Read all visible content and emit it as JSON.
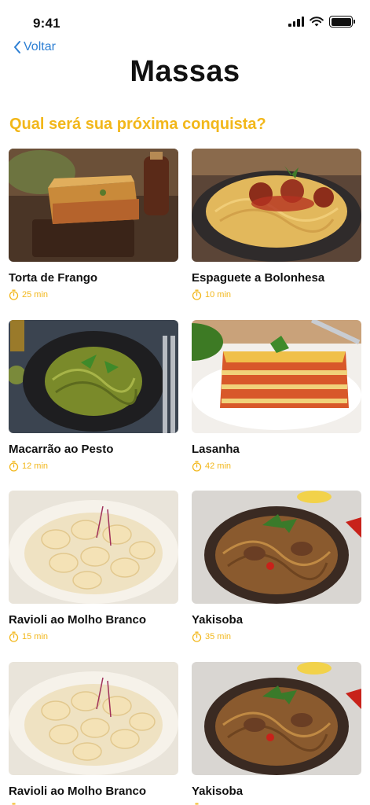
{
  "status_bar": {
    "time": "9:41"
  },
  "header": {
    "back_label": "Voltar",
    "title": "Massas"
  },
  "section": {
    "heading": "Qual será sua próxima conquista?"
  },
  "recipes": [
    {
      "name": "Torta de Frango",
      "time": "25 min",
      "image": "chicken-pie"
    },
    {
      "name": "Espaguete a Bolonhesa",
      "time": "10 min",
      "image": "spaghetti-meatballs"
    },
    {
      "name": "Macarrão ao Pesto",
      "time": "12 min",
      "image": "pesto-pasta"
    },
    {
      "name": "Lasanha",
      "time": "42 min",
      "image": "lasagna"
    },
    {
      "name": "Ravioli ao Molho Branco",
      "time": "15 min",
      "image": "ravioli"
    },
    {
      "name": "Yakisoba",
      "time": "35 min",
      "image": "yakisoba"
    },
    {
      "name": "Ravioli ao Molho Branco",
      "time": "",
      "image": "ravioli"
    },
    {
      "name": "Yakisoba",
      "time": "",
      "image": "yakisoba"
    }
  ],
  "colors": {
    "accent": "#f2b71a",
    "link": "#2d7fd3"
  }
}
